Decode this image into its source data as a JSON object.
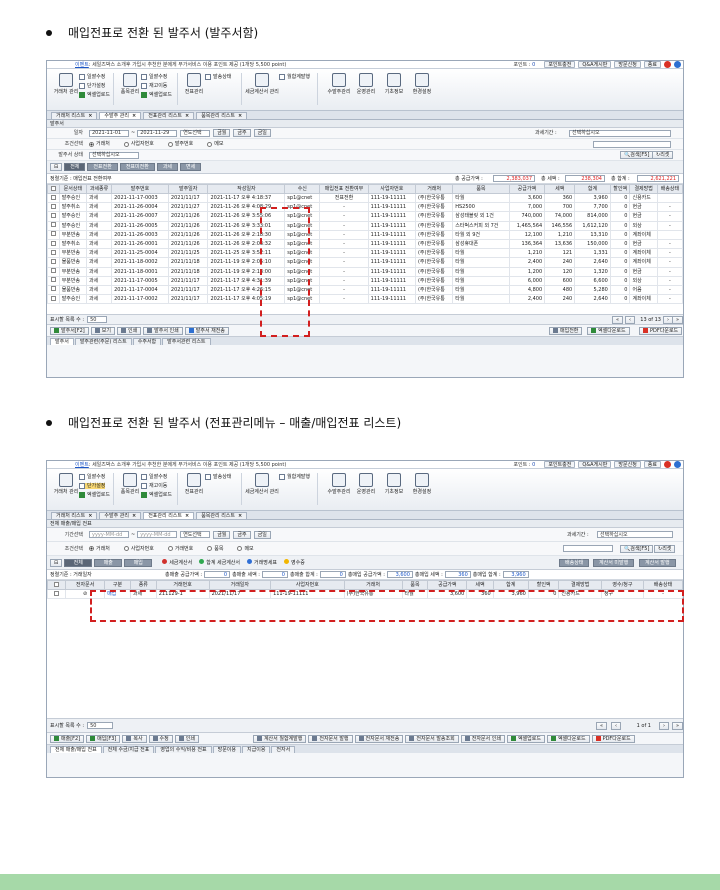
{
  "sections": [
    {
      "bullet": "매입전표로 전환 된 발주서 (발주서함)"
    },
    {
      "bullet": "매입전표로 전환 된 발주서 (전표관리메뉴 – 매출/매입전표 리스트)"
    }
  ],
  "topbar": {
    "notice_link": "이벤트",
    "notice_text": ": 세일즈박스 소개후 가입시 추천한 분에게 부가서비스 이용 포인트 제공 (1개당 5,500 point)",
    "point_label": "포인트 :",
    "point_value": "0",
    "buttons": [
      "포인트충전",
      "Q&A게시판",
      "방문신청",
      "종료"
    ]
  },
  "menu": {
    "groups": [
      "거래처 관리",
      "품목관리",
      "전표관리",
      "세금계산서 관리",
      "수발주관리",
      "운영관리",
      "기초정보",
      "환경설정"
    ],
    "small_items": [
      "일괄수정",
      "단가설정",
      "엑셀업로드",
      "일괄수정",
      "재고이동",
      "엑셀업로드",
      "발송상태",
      "월합계발행"
    ]
  },
  "screen1": {
    "tabs": [
      {
        "label": "거래처 리스트"
      },
      {
        "label": "수발주 관리"
      },
      {
        "label": "전표관리 리스트"
      },
      {
        "label": "품목관리 리스트"
      }
    ],
    "panel_title": "발주서",
    "filters": {
      "date_label": "일자",
      "date_from": "2021-11-01",
      "date_to": "2021-11-29",
      "period": "연도선택",
      "quick": [
        "금월",
        "금주",
        "금일"
      ],
      "company_label": "과세기간 :",
      "company_value": "선택하십시오",
      "cond_label": "조건선택",
      "cond_options": [
        "거래처",
        "사업자번호",
        "발주번호",
        "메모"
      ],
      "status_label": "발주서 상태",
      "status_value": "선택하십시오",
      "search_btn": "검색[F5]",
      "reset_btn": "리셋"
    },
    "segments": [
      "전체",
      "전표전환",
      "전표미전환",
      "과세",
      "면세"
    ],
    "summary": {
      "period_label": "정렬기준 : 매입전표 전환여부",
      "supply_label": "총 공급가액 :",
      "supply_value": "2,383,037",
      "tax_label": "총 세액 :",
      "tax_value": "238,304",
      "total_label": "총 합계 :",
      "total_value": "2,621,221"
    },
    "columns": [
      "",
      "문서상태",
      "과세종류",
      "발주번호",
      "발주일자",
      "작성일자",
      "수신",
      "매입전표 전환여부",
      "사업자번호",
      "거래처",
      "품목",
      "공급가액",
      "세액",
      "합계",
      "할인액",
      "결제방법",
      "배송상태"
    ],
    "rows": [
      [
        "",
        "발주승인",
        "과세",
        "2021-11-17-0003",
        "2021/11/17",
        "2021-11-17 오후 4:18:37",
        "sp1@cnet",
        "전표전환",
        "111-19-11111",
        "(주)한국유통",
        "타월",
        "3,600",
        "360",
        "3,960",
        "0",
        "신용카드",
        ""
      ],
      [
        "",
        "발주취소",
        "과세",
        "2021-11-26-0004",
        "2021/11/27",
        "2021-11-26 오후 4:08:29",
        "sp1@cnet",
        "-",
        "111-19-11111",
        "(주)한국유통",
        "HS2500",
        "7,000",
        "700",
        "7,700",
        "0",
        "현금",
        "-"
      ],
      [
        "",
        "발주승인",
        "과세",
        "2021-11-26-0007",
        "2021/11/26",
        "2021-11-26 오후 3:55:06",
        "sp1@cnet",
        "-",
        "111-19-11111",
        "(주)한국유통",
        "삼성태블릿 외 1건",
        "740,000",
        "74,000",
        "814,000",
        "0",
        "현금",
        "-"
      ],
      [
        "",
        "발주승인",
        "과세",
        "2021-11-26-0005",
        "2021/11/26",
        "2021-11-26 오후 3:33:01",
        "sp1@cnet",
        "-",
        "111-19-11111",
        "(주)한국유통",
        "스타벅스커피 외 7건",
        "1,465,564",
        "146,556",
        "1,612,120",
        "0",
        "외상",
        "-"
      ],
      [
        "",
        "부분반송",
        "과세",
        "2021-11-26-0003",
        "2021/11/26",
        "2021-11-26 오후 2:18:30",
        "sp1@cnet",
        "-",
        "111-19-11111",
        "(주)한국유통",
        "타월 외 9건",
        "12,100",
        "1,210",
        "13,310",
        "0",
        "계좌이체",
        ""
      ],
      [
        "",
        "발주취소",
        "과세",
        "2021-11-26-0001",
        "2021/11/26",
        "2021-11-26 오후 2:03:32",
        "sp1@cnet",
        "-",
        "111-19-11111",
        "(주)한국유통",
        "삼성휴대폰",
        "136,364",
        "13,636",
        "150,000",
        "0",
        "현금",
        "-"
      ],
      [
        "",
        "부분반송",
        "과세",
        "2021-11-25-0004",
        "2021/11/25",
        "2021-11-25 오후 3:52:11",
        "sp1@cnet",
        "-",
        "111-19-11111",
        "(주)한국유통",
        "타월",
        "1,210",
        "121",
        "1,331",
        "0",
        "계좌이체",
        "-"
      ],
      [
        "",
        "물품반송",
        "과세",
        "2021-11-18-0002",
        "2021/11/18",
        "2021-11-19 오후 2:05:10",
        "sp1@cnet",
        "-",
        "111-19-11111",
        "(주)한국유통",
        "타월",
        "2,400",
        "240",
        "2,640",
        "0",
        "계좌이체",
        "-"
      ],
      [
        "",
        "부분반송",
        "과세",
        "2021-11-18-0001",
        "2021/11/18",
        "2021-11-19 오후 2:13:00",
        "sp1@cnet",
        "-",
        "111-19-11111",
        "(주)한국유통",
        "타월",
        "1,200",
        "120",
        "1,320",
        "0",
        "현금",
        "-"
      ],
      [
        "",
        "부분반송",
        "과세",
        "2021-11-17-0005",
        "2021/11/17",
        "2021-11-17 오후 4:31:39",
        "sp1@cnet",
        "-",
        "111-19-11111",
        "(주)한국유통",
        "타월",
        "6,000",
        "600",
        "6,600",
        "0",
        "외상",
        "-"
      ],
      [
        "",
        "물품반송",
        "과세",
        "2021-11-17-0004",
        "2021/11/17",
        "2021-11-17 오후 4:26:15",
        "sp1@cnet",
        "-",
        "111-19-11111",
        "(주)한국유통",
        "타월",
        "4,800",
        "480",
        "5,280",
        "0",
        "어음",
        "-"
      ],
      [
        "",
        "발주승인",
        "과세",
        "2021-11-17-0002",
        "2021/11/17",
        "2021-11-17 오후 4:05:19",
        "sp1@cnet",
        "-",
        "111-19-11111",
        "(주)한국유통",
        "타월",
        "2,400",
        "240",
        "2,640",
        "0",
        "계좌이체",
        "-"
      ]
    ],
    "pager": {
      "rows_label": "표시할 목록 수 :",
      "rows_value": "50",
      "page_text": "13 of 13"
    },
    "bottom_buttons": [
      "발주서[F2]",
      "보기",
      "인쇄",
      "발주서 인쇄",
      "발주서 재전송"
    ],
    "bottom_right": [
      "매입전환",
      "엑셀다운로드",
      "PDF다운로드"
    ],
    "subtabs": [
      "발주서",
      "발주관련(주문) 리스트",
      "수주서함",
      "발주서관련 리스트"
    ]
  },
  "screen2": {
    "tabs": [
      {
        "label": "거래처 리스트"
      },
      {
        "label": "수발주 관리"
      },
      {
        "label": "전표관리 리스트"
      },
      {
        "label": "품목관리 리스트"
      }
    ],
    "panel_title": "전체 매출/매입 전표",
    "filters": {
      "date_label": "기간선택",
      "date_from": "yyyy-MM-dd",
      "date_to": "yyyy-MM-dd",
      "period": "연도선택",
      "quick": [
        "금월",
        "금주",
        "금일"
      ],
      "company_label": "과세기간 :",
      "company_value": "선택하십시오",
      "cond_label": "조건선택",
      "cond_options": [
        "거래처",
        "사업자번호",
        "거래번호",
        "품목",
        "메모"
      ],
      "search_btn": "검색[F5]",
      "reset_btn": "리셋"
    },
    "segments": [
      "전체",
      "매출",
      "매입"
    ],
    "legend": [
      "세금계산서",
      "합계 세금계산서",
      "거래명세표",
      "영수증"
    ],
    "legend_colors": [
      "#d0312d",
      "#2fa84f",
      "#2f6fd6",
      "#f2b600"
    ],
    "right_btns": [
      "배송상태",
      "계산서 미발행",
      "계산서 발행"
    ],
    "summary": {
      "label": "정렬기준 : 거래일자",
      "items": [
        "총매출 공급가액 :",
        "0",
        "총매출 세액 :",
        "0",
        "총매출 합계 :",
        "0",
        "총매입 공급가액 :",
        "3,600",
        "총매입 세액 :",
        "360",
        "총매입 합계 :",
        "3,960"
      ]
    },
    "columns": [
      "",
      "전자문서",
      "구분",
      "종류",
      "거래번호",
      "거래일자",
      "사업자번호",
      "거래처",
      "품목",
      "공급가액",
      "세액",
      "합계",
      "할인액",
      "결제방법",
      "영수/청구",
      "배송상태"
    ],
    "rows": [
      [
        "",
        "⊘",
        "매입",
        "과세",
        "211129-1",
        "2021/11/17",
        "111-19-11111",
        "(주)한국유통",
        "타월",
        "3,600",
        "360",
        "3,960",
        "0",
        "신용카드",
        "청구",
        "-"
      ]
    ],
    "pager": {
      "rows_label": "표시할 목록 수 :",
      "rows_value": "50",
      "page_text": "1 of 1"
    },
    "bottom_buttons": [
      "매출[F2]",
      "매입[F3]",
      "복사",
      "수정",
      "인쇄"
    ],
    "bottom_mid": [
      "계산서 월합계발행",
      "전자문서 발행",
      "전자문서 재전송",
      "전자문서 발송조회",
      "전자문서 인쇄",
      "엑셀업로드",
      "엑셀다운로드",
      "PDF다운로드"
    ],
    "subtabs": [
      "전체 매출/매입 전표",
      "전체 수금/지급 전표",
      "영업의 수익/비용 전표",
      "방문이용",
      "지급이용",
      "전자서"
    ]
  }
}
